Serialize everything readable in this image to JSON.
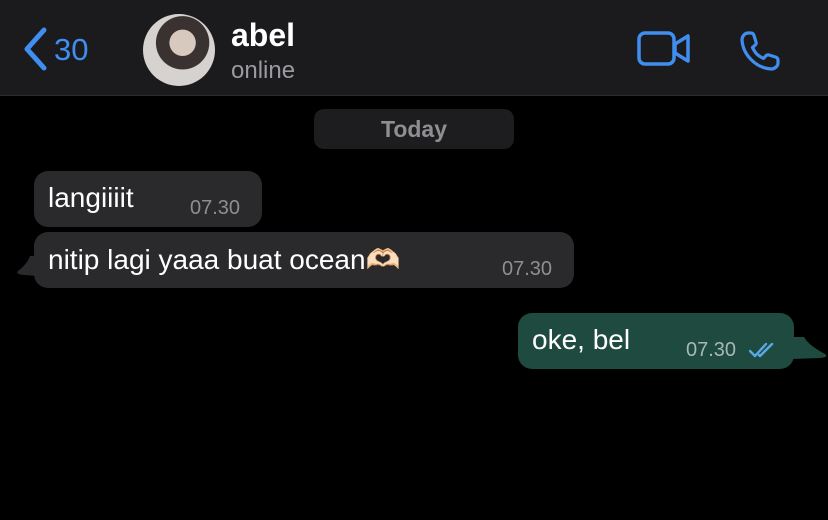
{
  "header": {
    "back_count": "30",
    "contact_name": "abel",
    "contact_status": "online",
    "icons": {
      "back": "chevron-left-icon",
      "video": "video-camera-icon",
      "call": "phone-icon"
    }
  },
  "date_separator": "Today",
  "messages": [
    {
      "direction": "incoming",
      "text": "langiiiit",
      "time": "07.30"
    },
    {
      "direction": "incoming",
      "text": "nitip lagi yaaa buat ocean🫶🏻",
      "time": "07.30"
    },
    {
      "direction": "outgoing",
      "text": "oke, bel",
      "time": "07.30",
      "status": "read"
    }
  ],
  "colors": {
    "accent": "#3f8ef0",
    "incoming_bubble": "#2a2a2c",
    "outgoing_bubble": "#1f4a3f",
    "read_ticks": "#5aa9e6"
  }
}
